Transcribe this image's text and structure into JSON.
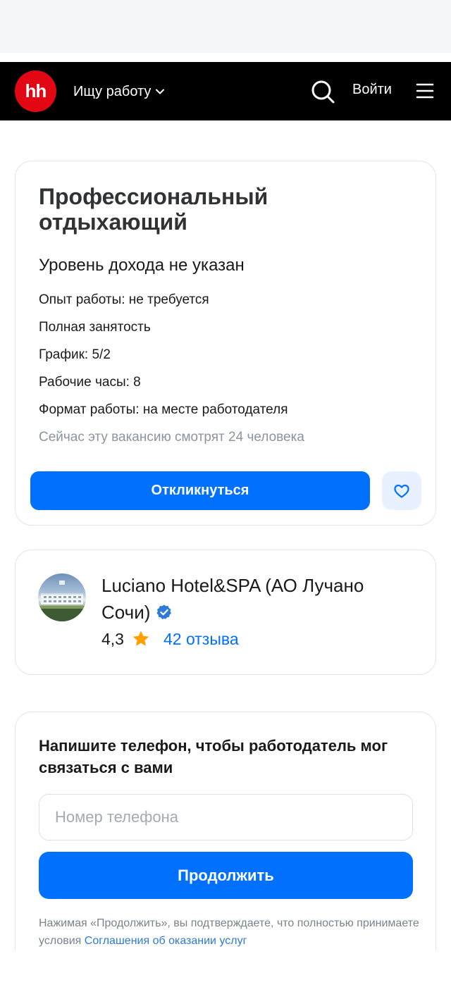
{
  "header": {
    "logo_text": "hh",
    "mode_label": "Ищу работу",
    "login_label": "Войти",
    "brand_color": "#e30613"
  },
  "vacancy": {
    "title": "Профессиональный отдыхающий",
    "salary": "Уровень дохода не указан",
    "experience": "Опыт работы: не требуется",
    "employment": "Полная занятость",
    "schedule": "График: 5/2",
    "hours": "Рабочие часы: 8",
    "format": "Формат работы: на месте работодателя",
    "viewers": "Сейчас эту вакансию смотрят 24 человека",
    "apply_label": "Откликнуться",
    "accent_color": "#0070ff"
  },
  "company": {
    "name": "Luciano Hotel&SPA (АО Лучано Сочи)",
    "rating": "4,3",
    "reviews_label": "42 отзыва",
    "verified_icon": "verified-check-icon"
  },
  "phone_form": {
    "title": "Напишите телефон, чтобы работодатель мог связаться с вами",
    "phone_placeholder": "Номер телефона",
    "continue_label": "Продолжить",
    "terms_text": "Нажимая «Продолжить», вы подтверждаете, что полностью принимаете условия ",
    "terms_link": "Соглашения об оказании услуг"
  }
}
